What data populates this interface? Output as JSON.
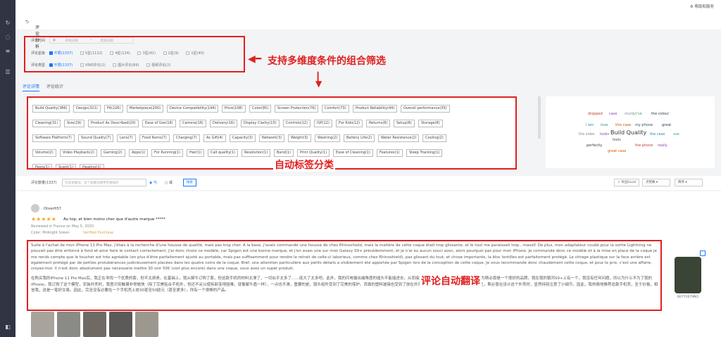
{
  "topbar": {
    "help_label": "帮助和服务"
  },
  "breadcrumb": {
    "title": "评论分析"
  },
  "filters": {
    "time_label": "评论时间",
    "start_placeholder": "开始日期",
    "end_placeholder": "结束日期",
    "rating_label": "评论星级",
    "ratings": [
      "不限(1337)",
      "5星(1122)",
      "4星(124)",
      "3星(42)",
      "2星(9)",
      "1星(40)"
    ],
    "type_label": "评论类型",
    "types": [
      "不限(1337)",
      "VINE评论(1)",
      "图片评论(66)",
      "视频评论(2)"
    ]
  },
  "annotations": {
    "filter_note": "支持多维度条件的组合筛选",
    "tags_note": "自动标签分类",
    "translate_note": "评论自动翻译"
  },
  "tabs": [
    "评论详情",
    "评论统计"
  ],
  "tags": [
    [
      "Build Quality(386)",
      "Design(321)",
      "Fit(226)",
      "Marketplace(200)",
      "Device Compatibility(144)",
      "Price(108)",
      "Color(85)",
      "Screen Protection(76)",
      "Comfort(73)",
      "Product Reliability(44)",
      "Overall performance(35)"
    ],
    [
      "Cleaning(31)",
      "Size(29)",
      "Product As Described(20)",
      "Ease of Use(18)",
      "Camera(16)",
      "Delivery(16)",
      "Display Clarity(15)",
      "Controls(12)",
      "ISP(12)",
      "For Kids(12)",
      "Returns(8)",
      "Setup(8)",
      "Storage(8)"
    ],
    [
      "Software Platform(7)",
      "Sound Quality(7)",
      "Lens(7)",
      "Food Items(7)",
      "Charging(7)",
      "As Gift(4)",
      "Capacity(3)",
      "Network(3)",
      "Weight(3)",
      "Washing(2)",
      "Battery Life(2)",
      "Water Resistance(2)",
      "Cooling(2)"
    ],
    [
      "Volume(2)",
      "Video Playback(2)",
      "Gaming(2)",
      "Apps(1)",
      "For Running(1)",
      "Hair(1)",
      "Call quality(1)",
      "Resolution(1)",
      "Band(1)",
      "Print Quality(1)",
      "Ease of Cleaning(1)",
      "Features(1)",
      "Sleep Tracking(1)"
    ],
    [
      "Pests(1)",
      "Scent(1)",
      "Heating(1)"
    ]
  ],
  "wordcloud": [
    "dropped",
    "case",
    "sturdy",
    "i've",
    "the colour",
    "i am",
    "love",
    "this case",
    "my phone",
    "great",
    "the sides",
    "looks",
    "Build Quality",
    "the case",
    "use",
    "feels",
    "perfectly",
    "the phone",
    "really",
    "great case"
  ],
  "search": {
    "count_label": "评论数量(1337)",
    "input_placeholder": "包含关键词，多个关键词请用空格隔开",
    "option_or": "与",
    "option_and": "或",
    "search_button": "搜索",
    "export_button": "导出Excel",
    "sort_helpful": "点赞数",
    "sort_order": "降序"
  },
  "review": {
    "author": "OliverH57",
    "stars": "★★★★★",
    "title": "Au top, et bien moins cher que d'autre marque *****",
    "meta": "Reviewed in France on May 5, 2020",
    "color": "Color: Midnight Green",
    "verified": "Verified Purchase",
    "original": "Suite à l'achat de mon iPhone 11 Pro Max, j'étais à la recherche d'une housse de qualité, mais pas trop cher. A la base, j'avais commandé une housse de chez Rhinoshield, mais la matière de cette coque était trop glissante, et le tout me paraissait trop...massif. De plus, mon adaptateur coudé pour la sortie Lightning ne pouvait pas être enfoncé à fond et ainsi faire le contact correctement. J'ai donc choisi ce modèle, car Spigen est une bonne marque, et j'en avais une sur mon Galaxy S9+ précédemment, et je n'ai eu aucun souci avec, alors pourquoi pas pour mon iPhone. Je commande donc ce modèle et à la mise en place de la coque je me rends compte que le toucher est très agréable (en plus d'être parfaitement ajusté au portable, mais pas suffisamment pour rendre le retrait de celle-ci laborieux, comme chez Rhinoshield), pas glissant du tout, et chose importante, la bloc lentilles est parfaitement protégé. Le vitrage plastique sur la face arrière est également protégé par de petites protubérances judicieusement placées dans les quatre coins de la coque. Bref, une attention particulière aux petits détails a visiblement été apportée par Spigen lors de la conception de cette coque. Je vous recommande donc chaudement cette coque, et pour le prix, c'est une affaire, croyez-moi. Il n'est donc absolument pas nécessaire mettre 30 voir 50€ (voir plus encore) dans une coque, vous avez un super produit.",
    "translation": "在购买我的iPhone 11 Pro Max后，我正在寻找一个优质的套，但不太昂贵。在基础上，我从犀牛订购了套，但这款手机的材料太滑了，一切似乎太多了……庞大了太多吧。此外，我的闪电输出端角度的插头不能插进去，从而接触不良。所以我选择了这个模型，因为斯必恩是一个很好的品牌，我在我的银河S9+上有一个，我没有任何问题，所以为什么不为了我的iPhone。我订购了这个模型，安装外壳时，我意识到触摸非常愉快（除了完美贴合手机外，但还不足以使拆卸变得困难，就像犀牛盾一样），一点也不滑，重要的是，镜头组件受到了完美的保护。背面的塑料玻璃也受到了放在外壳四个角落的小凸起的保护。简而言之，斯必恩在设计这个外壳时，显然特别注意了小细节。因此，我热情地推荐这款手机壳，至于价格，相信我，这是一笔好交易。因此，完全没有必要在一个手机壳上放30甚至50欧元（甚至更多），你有一个很棒的产品。",
    "product_asin": "B07Y1679NQ"
  }
}
